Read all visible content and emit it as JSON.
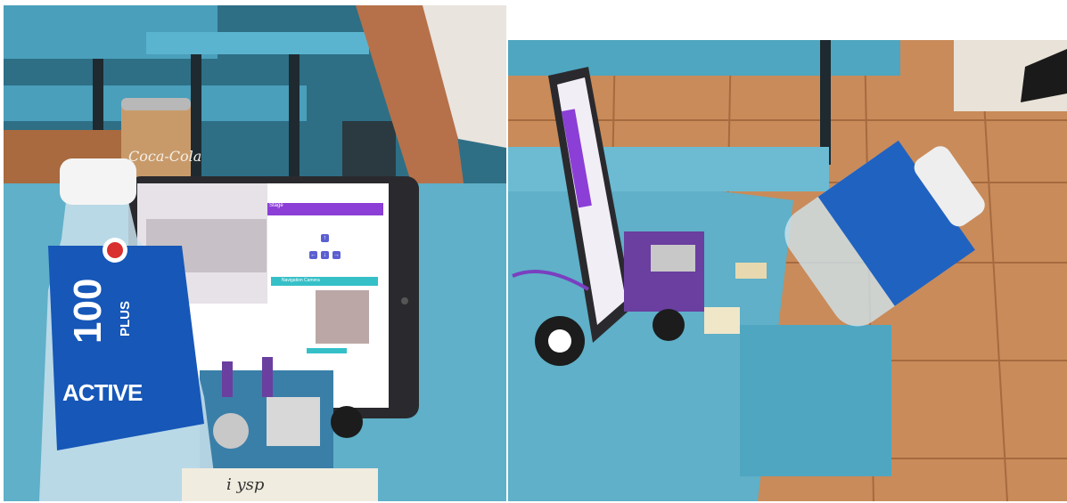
{
  "left_photo": {
    "can_label": "Coca-Cola",
    "bottle_brand_number": "100",
    "bottle_brand_word": "PLUS",
    "bottle_variant": "ACTIVE",
    "tablet_app": {
      "header_title": "Stage",
      "panel_title": "Navigation Camera",
      "arrow_up": "↑",
      "arrow_left": "←",
      "arrow_down": "↓",
      "arrow_right": "→"
    },
    "note_text": "i ysp"
  },
  "right_photo": {},
  "colors": {
    "table_blue": "#5fb0c8",
    "app_purple": "#8b3fd6",
    "panel_teal": "#35c0c8",
    "floor_tile": "#c98b5a",
    "robot_purple": "#6a3fa0"
  }
}
